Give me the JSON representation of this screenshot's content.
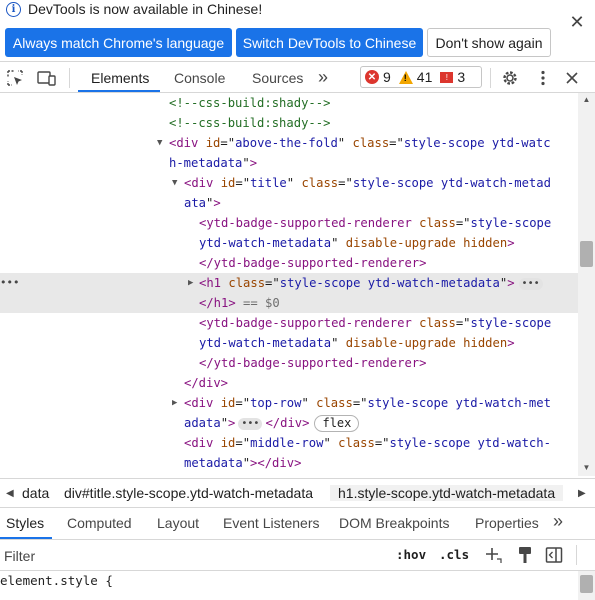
{
  "infobar": {
    "message": "DevTools is now available in Chinese!",
    "btn_match": "Always match Chrome's language",
    "btn_switch": "Switch DevTools to Chinese",
    "btn_dont_show": "Don't show again",
    "close_glyph": "✕"
  },
  "toolbar": {
    "tabs": [
      "Elements",
      "Console",
      "Sources"
    ],
    "more_tabs_glyph": "»",
    "errors": "9",
    "warnings": "41",
    "issues": "3"
  },
  "dom": {
    "lines": [
      {
        "parts": [
          [
            "c",
            "<!--css-build:shady-->"
          ]
        ]
      },
      {
        "parts": [
          [
            "c",
            "<!--css-build:shady-->"
          ]
        ]
      },
      {
        "parts": [
          [
            "t",
            "<div "
          ],
          [
            "a",
            "id"
          ],
          [
            "p",
            "=\""
          ],
          [
            "v",
            "above-the-fold"
          ],
          [
            "p",
            "\" "
          ],
          [
            "a",
            "class"
          ],
          [
            "p",
            "=\""
          ],
          [
            "v",
            "style-scope ytd-watc"
          ]
        ]
      },
      {
        "parts": [
          [
            "v",
            "h-metadata"
          ],
          [
            "p",
            "\""
          ],
          [
            "t",
            ">"
          ]
        ]
      },
      {
        "parts": [
          [
            "t",
            "<div "
          ],
          [
            "a",
            "id"
          ],
          [
            "p",
            "=\""
          ],
          [
            "v",
            "title"
          ],
          [
            "p",
            "\" "
          ],
          [
            "a",
            "class"
          ],
          [
            "p",
            "=\""
          ],
          [
            "v",
            "style-scope ytd-watch-metad"
          ]
        ]
      },
      {
        "parts": [
          [
            "v",
            "ata"
          ],
          [
            "p",
            "\""
          ],
          [
            "t",
            ">"
          ]
        ]
      },
      {
        "parts": [
          [
            "t",
            "<ytd-badge-supported-renderer "
          ],
          [
            "a",
            "class"
          ],
          [
            "p",
            "=\""
          ],
          [
            "v",
            "style-scope"
          ]
        ]
      },
      {
        "parts": [
          [
            "v",
            "ytd-watch-metadata"
          ],
          [
            "p",
            "\" "
          ],
          [
            "a",
            "disable-upgrade hidden"
          ],
          [
            "t",
            ">"
          ]
        ]
      },
      {
        "parts": [
          [
            "t",
            "</ytd-badge-supported-renderer>"
          ]
        ]
      },
      {
        "parts": [
          [
            "t",
            "<h1 "
          ],
          [
            "a",
            "class"
          ],
          [
            "p",
            "=\""
          ],
          [
            "v",
            "style-scope ytd-watch-metadata"
          ],
          [
            "p",
            "\""
          ],
          [
            "t",
            ">"
          ]
        ]
      },
      {
        "parts": [
          [
            "t",
            "</h1>"
          ],
          [
            "d",
            " == $0"
          ]
        ]
      },
      {
        "parts": [
          [
            "t",
            "<ytd-badge-supported-renderer "
          ],
          [
            "a",
            "class"
          ],
          [
            "p",
            "=\""
          ],
          [
            "v",
            "style-scope"
          ]
        ]
      },
      {
        "parts": [
          [
            "v",
            "ytd-watch-metadata"
          ],
          [
            "p",
            "\" "
          ],
          [
            "a",
            "disable-upgrade hidden"
          ],
          [
            "t",
            ">"
          ]
        ]
      },
      {
        "parts": [
          [
            "t",
            "</ytd-badge-supported-renderer>"
          ]
        ]
      },
      {
        "parts": [
          [
            "t",
            "</div>"
          ]
        ]
      },
      {
        "parts": [
          [
            "t",
            "<div "
          ],
          [
            "a",
            "id"
          ],
          [
            "p",
            "=\""
          ],
          [
            "v",
            "top-row"
          ],
          [
            "p",
            "\" "
          ],
          [
            "a",
            "class"
          ],
          [
            "p",
            "=\""
          ],
          [
            "v",
            "style-scope ytd-watch-met"
          ]
        ]
      },
      {
        "parts": [
          [
            "v",
            "adata"
          ],
          [
            "p",
            "\""
          ],
          [
            "t",
            ">"
          ]
        ]
      },
      {
        "parts": [
          [
            "t",
            "<div "
          ],
          [
            "a",
            "id"
          ],
          [
            "p",
            "=\""
          ],
          [
            "v",
            "middle-row"
          ],
          [
            "p",
            "\" "
          ],
          [
            "a",
            "class"
          ],
          [
            "p",
            "=\""
          ],
          [
            "v",
            "style-scope ytd-watch-"
          ]
        ]
      },
      {
        "parts": [
          [
            "v",
            "metadata"
          ],
          [
            "p",
            "\""
          ],
          [
            "t",
            "></div>"
          ]
        ]
      }
    ],
    "flex_badge": "flex",
    "ellipsis": "•••",
    "after_top_row": "</div>",
    "row_dots": "•••"
  },
  "breadcrumbs": [
    "data",
    "div#title.style-scope.ytd-watch-metadata",
    "h1.style-scope.ytd-watch-metadata"
  ],
  "subtabs": [
    "Styles",
    "Computed",
    "Layout",
    "Event Listeners",
    "DOM Breakpoints",
    "Properties"
  ],
  "subtabs_more": "»",
  "filter": {
    "placeholder": "Filter",
    "hov": ":hov",
    "cls": ".cls"
  },
  "styles_pane": {
    "selector": "element.style {"
  },
  "colors": {
    "accent": "#1a73e8",
    "tag": "#881280",
    "attr": "#994500",
    "value": "#1a1aa6",
    "comment": "#236e25"
  }
}
